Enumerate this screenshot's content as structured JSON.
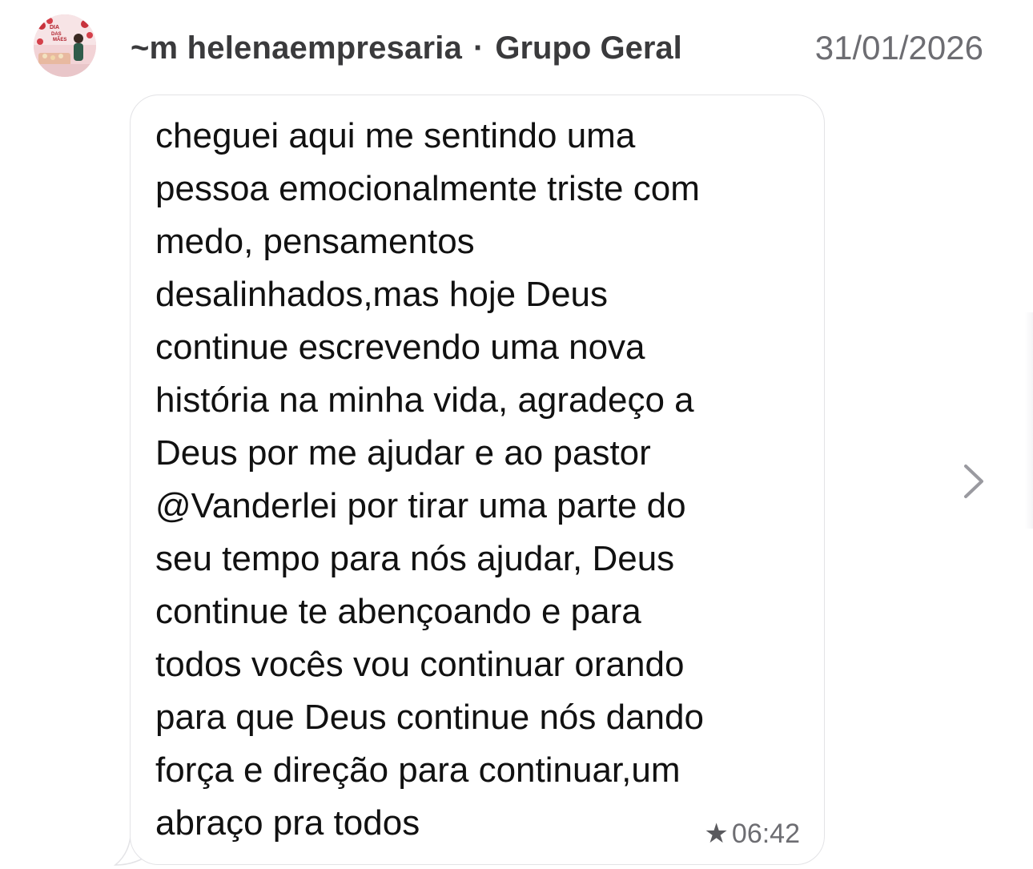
{
  "header": {
    "sender": "~m helenaempresaria",
    "separator": "·",
    "group": "Grupo Geral",
    "date": "31/01/2026"
  },
  "avatar": {
    "icon": "profile-photo",
    "overlay_text": "DIA DAS MÃES"
  },
  "message": {
    "text": "cheguei aqui me sentindo uma\npessoa emocionalmente triste com\nmedo, pensamentos\ndesalinhados,mas hoje Deus\ncontinue escrevendo uma nova\nhistória na minha vida, agradeço a\nDeus por me ajudar e ao pastor\n@Vanderlei por tirar uma parte do\nseu tempo para nós ajudar, Deus\ncontinue te abençoando e para\ntodos vocês vou continuar orando\npara que Deus continue nós dando\nforça e direção para continuar,um\nabraço pra todos",
    "star": "★",
    "time": "06:42"
  },
  "navigation": {
    "next_icon": "chevron-right-icon"
  },
  "colors": {
    "text": "#111111",
    "meta": "#6d6d72",
    "bubble_border": "#e3e3e6"
  }
}
